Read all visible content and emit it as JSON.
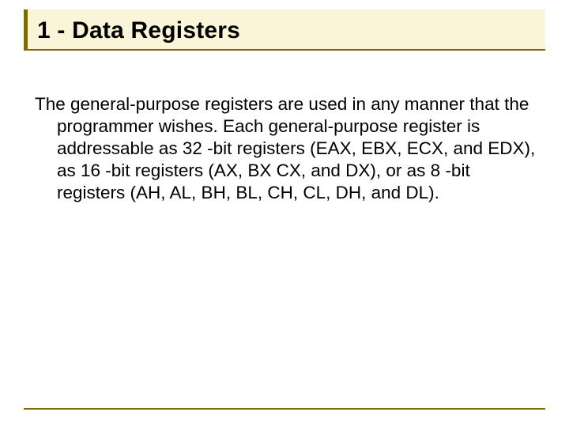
{
  "slide": {
    "title": "1 - Data Registers",
    "body": "The general-purpose registers are used in any manner that the programmer wishes. Each general-purpose register is addressable as 32 -bit registers (EAX, EBX, ECX, and EDX), as 16 -bit registers (AX, BX CX, and DX), or as 8 -bit registers (AH, AL, BH, BL, CH, CL, DH, and DL)."
  }
}
